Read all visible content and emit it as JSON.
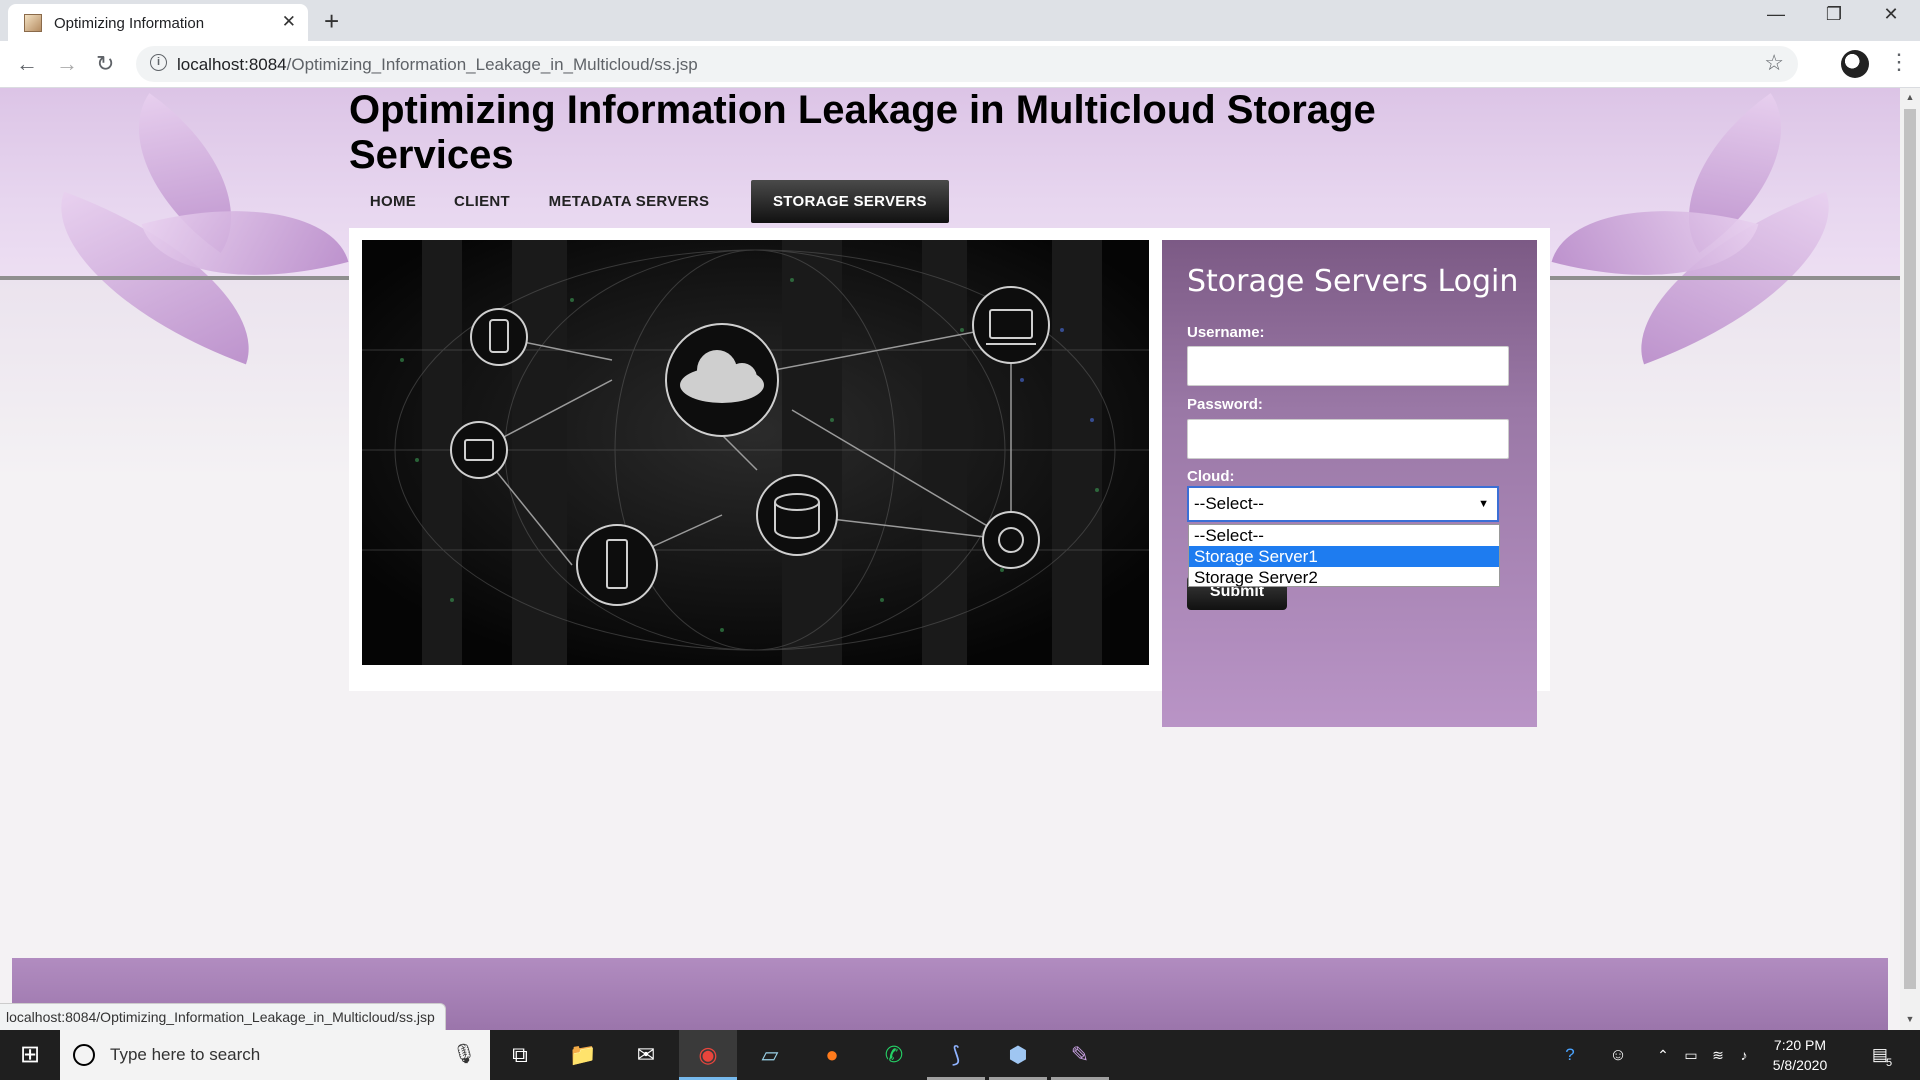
{
  "browser": {
    "tab_title": "Optimizing Information",
    "new_tab": "+",
    "url_host": "localhost:8084",
    "url_path": "/Optimizing_Information_Leakage_in_Multicloud/ss.jsp"
  },
  "site": {
    "title": "Optimizing Information Leakage in Multicloud Storage Services",
    "nav": [
      "HOME",
      "CLIENT",
      "METADATA SERVERS",
      "STORAGE SERVERS"
    ],
    "active_nav": "STORAGE SERVERS"
  },
  "login": {
    "heading": "Storage Servers Login",
    "username_label": "Username:",
    "password_label": "Password:",
    "cloud_label": "Cloud:",
    "cloud_selected": "--Select--",
    "cloud_options": [
      "--Select--",
      "Storage Server1",
      "Storage Server2"
    ],
    "highlighted_option": "Storage Server1",
    "submit_label": "Submit"
  },
  "statusbar": {
    "link": "localhost:8084/Optimizing_Information_Leakage_in_Multicloud/ss.jsp"
  },
  "taskbar": {
    "search_placeholder": "Type here to search",
    "time": "7:20 PM",
    "date": "5/8/2020",
    "notification_count": "5"
  },
  "colors": {
    "header": "#dcc4e6",
    "login_panel": "#9a78a6",
    "nav_active": "#111111",
    "dropdown_highlight": "#1e7cf0"
  }
}
